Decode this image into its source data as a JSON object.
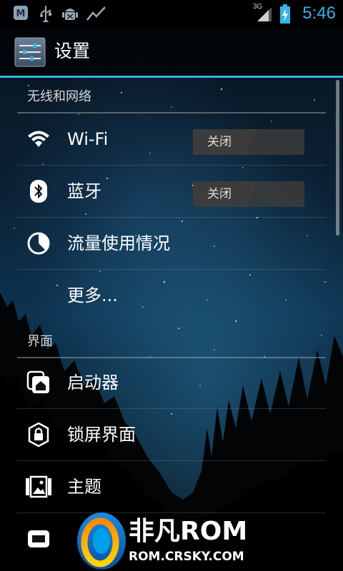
{
  "status_bar": {
    "time": "5:46",
    "network": "3G",
    "icons": [
      "m-app-icon",
      "usb-icon",
      "android-debug-icon",
      "activity-icon",
      "signal-icon",
      "battery-charging-icon"
    ]
  },
  "action_bar": {
    "title": "设置",
    "icon": "settings-sliders-icon"
  },
  "sections": {
    "wireless": {
      "header": "无线和网络",
      "items": [
        {
          "label": "Wi-Fi",
          "icon": "wifi-icon",
          "toggle": "关闭"
        },
        {
          "label": "蓝牙",
          "icon": "bluetooth-icon",
          "toggle": "关闭"
        },
        {
          "label": "流量使用情况",
          "icon": "data-usage-icon"
        },
        {
          "label": "更多..."
        }
      ]
    },
    "interface": {
      "header": "界面",
      "items": [
        {
          "label": "启动器",
          "icon": "launcher-icon"
        },
        {
          "label": "锁屏界面",
          "icon": "lock-icon"
        },
        {
          "label": "主题",
          "icon": "theme-icon"
        },
        {
          "label": "",
          "icon": "sound-icon"
        }
      ]
    }
  },
  "watermark": {
    "brand": "非凡ROM",
    "url": "ROM.CRSKY.COM"
  },
  "colors": {
    "accent": "#33b5e5",
    "watermark_green": "#8ee62a"
  }
}
